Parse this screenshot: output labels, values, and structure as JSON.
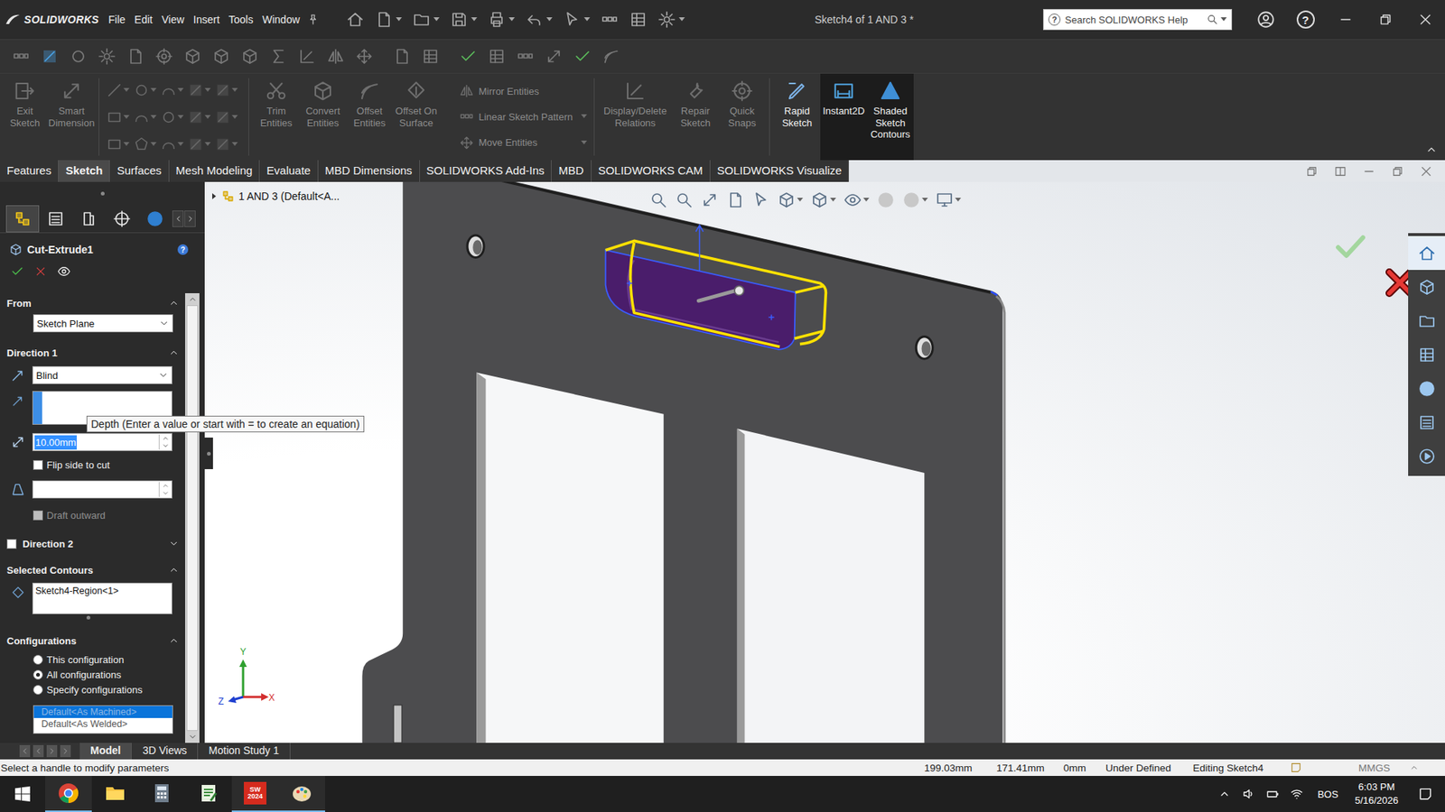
{
  "window": {
    "app": "SOLIDWORKS",
    "title": "Sketch4 of 1 AND 3 *",
    "help": "?"
  },
  "menu": [
    "File",
    "Edit",
    "View",
    "Insert",
    "Tools",
    "Window"
  ],
  "search": {
    "placeholder": "Search SOLIDWORKS Help"
  },
  "ribbon": {
    "sketch_group": [
      {
        "label": "Exit Sketch",
        "disabled": true,
        "pressed": false
      },
      {
        "label": "Smart Dimension",
        "disabled": true,
        "pressed": false
      }
    ],
    "entities_group": [
      {
        "label": "Trim Entities",
        "disabled": true,
        "pressed": false
      },
      {
        "label": "Convert Entities",
        "disabled": true,
        "pressed": false
      },
      {
        "label": "Offset Entities",
        "disabled": true,
        "pressed": false
      },
      {
        "label": "Offset On Surface",
        "disabled": true,
        "pressed": false
      }
    ],
    "pattern_group": [
      {
        "label": "Mirror Entities",
        "disabled": true
      },
      {
        "label": "Linear Sketch Pattern",
        "disabled": true
      },
      {
        "label": "Move Entities",
        "disabled": true
      }
    ],
    "relations_group": [
      {
        "label": "Display/Delete Relations",
        "disabled": true,
        "pressed": false
      },
      {
        "label": "Repair Sketch",
        "disabled": true,
        "pressed": false
      },
      {
        "label": "Quick Snaps",
        "disabled": true,
        "pressed": false
      }
    ],
    "mode_group": [
      {
        "label": "Rapid Sketch",
        "disabled": false,
        "pressed": false
      },
      {
        "label": "Instant2D",
        "disabled": false,
        "pressed": true
      },
      {
        "label": "Shaded Sketch Contours",
        "disabled": false,
        "pressed": true
      }
    ]
  },
  "tabs": [
    {
      "label": "Features",
      "selected": false
    },
    {
      "label": "Sketch",
      "selected": true
    },
    {
      "label": "Surfaces",
      "selected": false
    },
    {
      "label": "Mesh Modeling",
      "selected": false
    },
    {
      "label": "Evaluate",
      "selected": false
    },
    {
      "label": "MBD Dimensions",
      "selected": false
    },
    {
      "label": "SOLIDWORKS Add-Ins",
      "selected": false
    },
    {
      "label": "MBD",
      "selected": false
    },
    {
      "label": "SOLIDWORKS CAM",
      "selected": false
    },
    {
      "label": "SOLIDWORKS Visualize",
      "selected": false
    }
  ],
  "manager_tabs": [
    {
      "kind": "tree",
      "selected": true
    },
    {
      "kind": "list",
      "selected": false
    },
    {
      "kind": "config",
      "selected": false
    },
    {
      "kind": "target",
      "selected": false
    },
    {
      "kind": "sphere",
      "selected": false
    }
  ],
  "property_manager": {
    "title": "Cut-Extrude1",
    "help": "?",
    "from": {
      "label": "From",
      "expanded": true,
      "value": "Sketch Plane"
    },
    "direction1": {
      "label": "Direction 1",
      "expanded": true,
      "end_condition": "Blind",
      "direction": "",
      "direction_active": true,
      "depth": "10.00mm",
      "depth_selected": true,
      "flip": {
        "label": "Flip side to cut",
        "checked": false
      },
      "draft": "",
      "draft_outward": {
        "label": "Draft outward",
        "checked": false,
        "disabled": true
      }
    },
    "direction2": {
      "label": "Direction 2",
      "checked": false,
      "expanded": false
    },
    "selected_contours": {
      "label": "Selected Contours",
      "expanded": true,
      "items": [
        "Sketch4-Region<1>"
      ]
    },
    "configurations": {
      "label": "Configurations",
      "expanded": true,
      "options": [
        {
          "label": "This configuration",
          "selected": false
        },
        {
          "label": "All configurations",
          "selected": true
        },
        {
          "label": "Specify configurations",
          "selected": false
        }
      ],
      "list_disabled": true,
      "list": [
        {
          "label": "Default<As Machined>",
          "selected": true
        },
        {
          "label": "Default<As Welded>",
          "selected": false
        }
      ]
    }
  },
  "tooltip": "Depth (Enter a value or start with = to create an equation)",
  "feature_tree": {
    "label": "1 AND 3 (Default<A...",
    "expanded": false
  },
  "triad": {
    "x": "X",
    "y": "Y",
    "z": "Z"
  },
  "task_pane": [
    {
      "kind": "home",
      "selected": true
    },
    {
      "kind": "cube",
      "selected": false
    },
    {
      "kind": "folder",
      "selected": false
    },
    {
      "kind": "grid",
      "selected": false
    },
    {
      "kind": "sphere",
      "selected": false
    },
    {
      "kind": "list",
      "selected": false
    },
    {
      "kind": "play",
      "selected": false
    }
  ],
  "bottom_tabs": [
    {
      "label": "Model",
      "selected": true
    },
    {
      "label": "3D Views",
      "selected": false
    },
    {
      "label": "Motion Study 1",
      "selected": false
    }
  ],
  "status_bar": {
    "message": "Select a handle to modify parameters",
    "fields": [
      "199.03mm",
      "171.41mm",
      "0mm",
      "Under Defined",
      "Editing Sketch4"
    ],
    "units": "MMGS"
  },
  "taskbar": {
    "apps": [
      {
        "kind": "chrome",
        "running": true
      },
      {
        "kind": "explorer",
        "running": false
      },
      {
        "kind": "calculator",
        "running": false
      },
      {
        "kind": "notepad",
        "running": false
      },
      {
        "kind": "solidworks",
        "running": true,
        "badge": [
          "SW",
          "2024"
        ]
      },
      {
        "kind": "paint",
        "running": true
      }
    ],
    "language": "BOS",
    "time": "6:03 PM",
    "date": "5/16/2026"
  }
}
